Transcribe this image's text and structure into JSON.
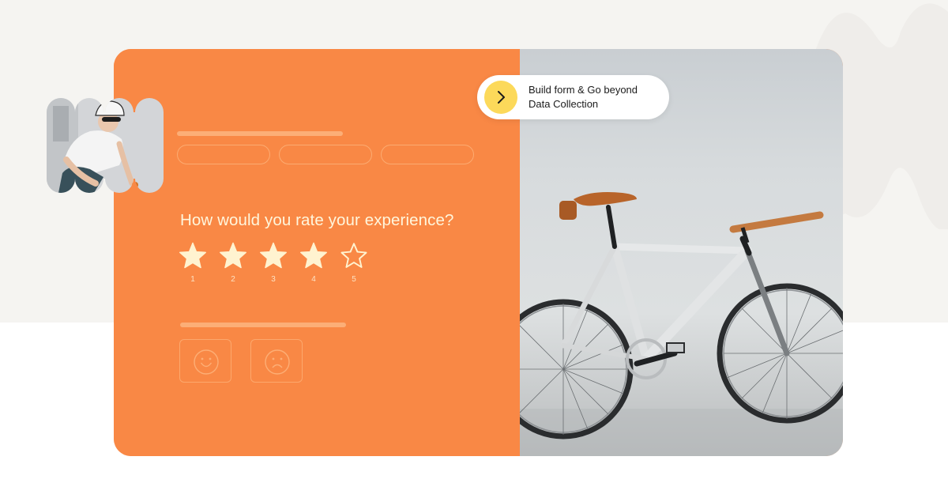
{
  "cta": {
    "line1": "Build form & Go beyond",
    "line2": "Data Collection",
    "icon": "chevron-right-icon",
    "accent": "#fcd95a"
  },
  "form": {
    "question": "How would you rate your experience?",
    "rating": {
      "value": 4,
      "max": 5,
      "labels": [
        "1",
        "2",
        "3",
        "4",
        "5"
      ]
    },
    "feedback_icons": [
      "smile-icon",
      "frown-icon"
    ]
  },
  "colors": {
    "card": "#f98845",
    "star": "#fff3d0",
    "background_top": "#f5f4f1",
    "background_bottom": "#ffffff"
  },
  "images": {
    "avatar": "woman cyclist in white helmet and sunglasses",
    "hero": "silver fixed-gear bicycle with brown leather saddle leaning against a white wall"
  }
}
